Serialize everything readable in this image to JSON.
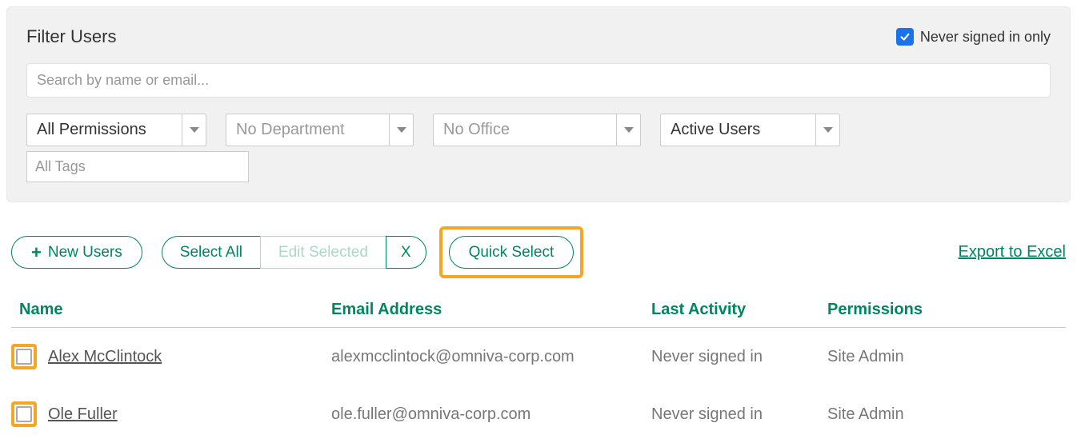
{
  "filter": {
    "title": "Filter Users",
    "never_signed_in_label": "Never signed in only",
    "never_signed_in_checked": true,
    "search_placeholder": "Search by name or email...",
    "dropdowns": {
      "permissions": "All Permissions",
      "department": "No Department",
      "office": "No Office",
      "status": "Active Users"
    },
    "tags_placeholder": "All Tags"
  },
  "actions": {
    "new_users": "New Users",
    "select_all": "Select All",
    "edit_selected": "Edit Selected",
    "clear": "X",
    "quick_select": "Quick Select",
    "export": "Export to Excel"
  },
  "table": {
    "headers": {
      "name": "Name",
      "email": "Email Address",
      "activity": "Last Activity",
      "permissions": "Permissions"
    },
    "rows": [
      {
        "name": "Alex McClintock",
        "email": "alexmcclintock@omniva-corp.com",
        "activity": "Never signed in",
        "permissions": "Site Admin"
      },
      {
        "name": "Ole Fuller",
        "email": "ole.fuller@omniva-corp.com",
        "activity": "Never signed in",
        "permissions": "Site Admin"
      }
    ]
  }
}
